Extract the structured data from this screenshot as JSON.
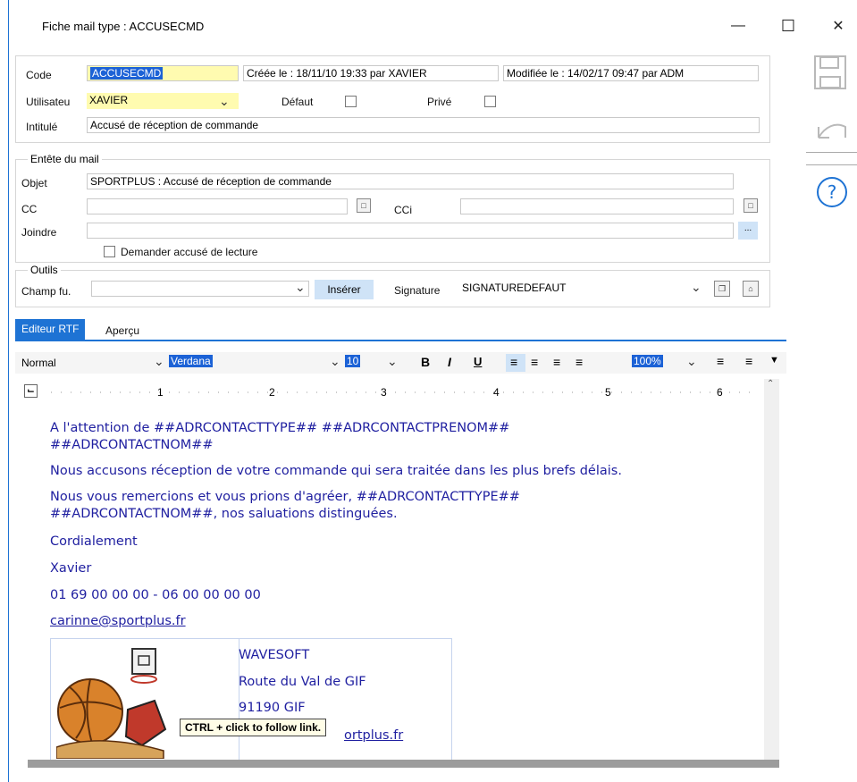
{
  "window": {
    "title": "Fiche mail type : ACCUSECMD",
    "minimize": "—",
    "maximize": "☐",
    "close": "✕"
  },
  "form": {
    "code_label": "Code",
    "code_value": "ACCUSECMD",
    "created": "Créée le : 18/11/10 19:33 par XAVIER",
    "modified": "Modifiée le : 14/02/17 09:47 par ADM",
    "user_label": "Utilisateu",
    "user_value": "XAVIER",
    "default_label": "Défaut",
    "private_label": "Privé",
    "title_label": "Intitulé",
    "title_value": "Accusé de réception de commande"
  },
  "header": {
    "legend": "Entête du mail",
    "subject_label": "Objet",
    "subject_value": "SPORTPLUS : Accusé de réception de commande",
    "cc_label": "CC",
    "cc_value": "",
    "bcc_label": "CCi",
    "bcc_value": "",
    "attach_label": "Joindre",
    "attach_value": "",
    "attach_btn": "...",
    "read_receipt_label": "Demander accusé de lecture"
  },
  "tools": {
    "legend": "Outils",
    "field_label": "Champ fu.",
    "field_value": "",
    "insert_btn": "Insérer",
    "signature_label": "Signature",
    "signature_value": "SIGNATUREDEFAUT"
  },
  "tabs": [
    "Editeur RTF",
    "Aperçu"
  ],
  "toolbar": {
    "style": "Normal",
    "font": "Verdana",
    "size": "10",
    "bold": "B",
    "italic": "I",
    "underline": "U",
    "zoom": "100%"
  },
  "ruler": {
    "numbers": [
      "1",
      "2",
      "3",
      "4",
      "5",
      "6"
    ],
    "side_numbers": [
      "1",
      "2",
      "3"
    ]
  },
  "document": {
    "lines": [
      "A l'attention de ##ADRCONTACTTYPE## ##ADRCONTACTPRENOM##",
      "##ADRCONTACTNOM##",
      "Nous accusons réception de votre commande qui sera traitée dans les plus brefs délais.",
      "Nous vous remercions et vous prions d'agréer, ##ADRCONTACTTYPE##",
      "##ADRCONTACTNOM##, nos saluations distinguées.",
      "Cordialement",
      "Xavier",
      "01 69 00 00 00 - 06 00 00 00 00"
    ],
    "email_link": "carinne@sportplus.fr",
    "company": "WAVESOFT",
    "address": "Route du Val de GIF",
    "zip_city": "91190 GIF",
    "site_link_partial": "ortplus.fr"
  },
  "tooltip": "CTRL + click to follow link.",
  "colors": {
    "accent": "#1e73d4",
    "doc_text": "#1f1fa0",
    "highlight_yellow": "#fffbb0"
  },
  "icons": {
    "save": "floppy-disk",
    "undo": "undo-arrow",
    "help": "question-circle"
  }
}
